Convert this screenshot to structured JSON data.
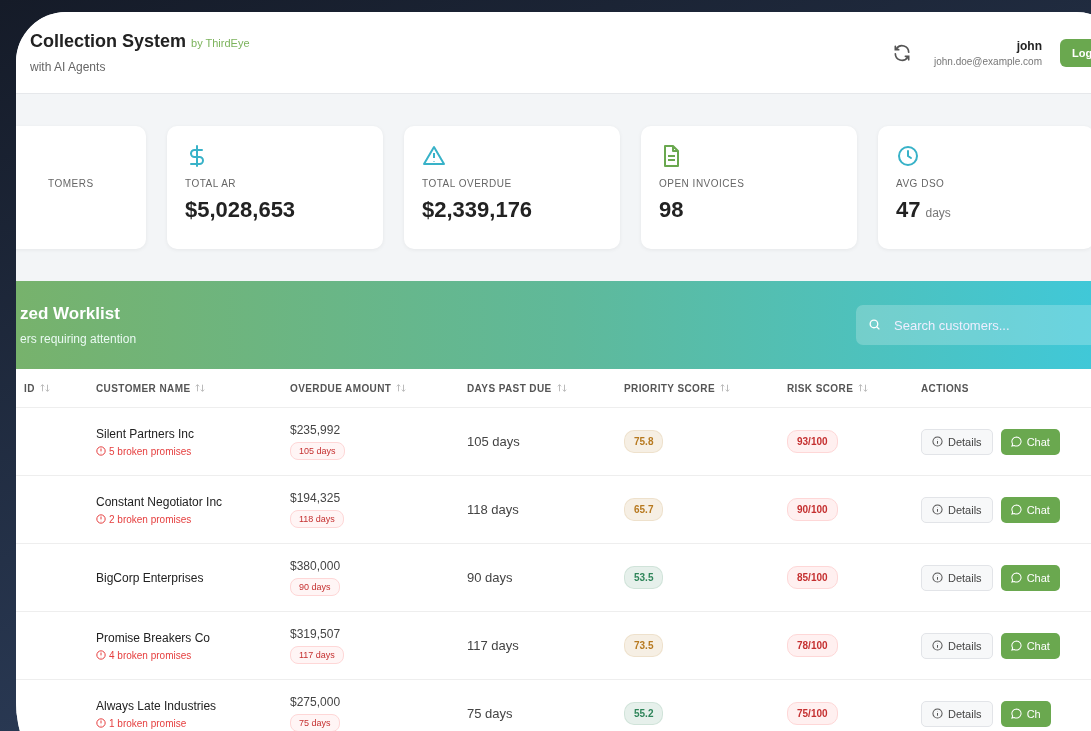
{
  "header": {
    "title": "Collection System",
    "brand": "by ThirdEye",
    "subtitle": "with AI Agents",
    "user_name": "john",
    "user_email": "john.doe@example.com",
    "logout": "Log"
  },
  "stats": [
    {
      "label": "TOMERS"
    },
    {
      "label": "TOTAL AR",
      "value": "$5,028,653"
    },
    {
      "label": "TOTAL OVERDUE",
      "value": "$2,339,176"
    },
    {
      "label": "OPEN INVOICES",
      "value": "98"
    },
    {
      "label": "AVG DSO",
      "value": "47",
      "unit": "days"
    }
  ],
  "worklist": {
    "title": "zed Worklist",
    "subtitle": "ers requiring attention",
    "search": {
      "placeholder": "Search customers..."
    }
  },
  "table": {
    "columns": [
      "ID",
      "CUSTOMER NAME",
      "OVERDUE AMOUNT",
      "DAYS PAST DUE",
      "PRIORITY SCORE",
      "RISK SCORE",
      "ACTIONS"
    ],
    "rows": [
      {
        "name": "Silent Partners Inc",
        "promises": "5 broken promises",
        "amount": "$235,992",
        "days_badge": "105 days",
        "days": "105 days",
        "priority": "75.8",
        "color": "#b7791f",
        "risk": "93/100",
        "details": "Details",
        "chat": "Chat"
      },
      {
        "name": "Constant Negotiator Inc",
        "promises": "2 broken promises",
        "amount": "$194,325",
        "days_badge": "118 days",
        "days": "118 days",
        "priority": "65.7",
        "color": "#b7791f",
        "risk": "90/100",
        "details": "Details",
        "chat": "Chat"
      },
      {
        "name": "BigCorp Enterprises",
        "amount": "$380,000",
        "days_badge": "90 days",
        "days": "90 days",
        "priority": "53.5",
        "color": "#2f855a",
        "risk": "85/100",
        "details": "Details",
        "chat": "Chat"
      },
      {
        "name": "Promise Breakers Co",
        "promises": "4 broken promises",
        "amount": "$319,507",
        "days_badge": "117 days",
        "days": "117 days",
        "priority": "73.5",
        "color": "#b7791f",
        "risk": "78/100",
        "details": "Details",
        "chat": "Chat"
      },
      {
        "name": "Always Late Industries",
        "promises": "1 broken promise",
        "amount": "$275,000",
        "days_badge": "75 days",
        "days": "75 days",
        "priority": "55.2",
        "color": "#2f855a",
        "risk": "75/100",
        "details": "Details",
        "chat": "Ch"
      }
    ]
  }
}
